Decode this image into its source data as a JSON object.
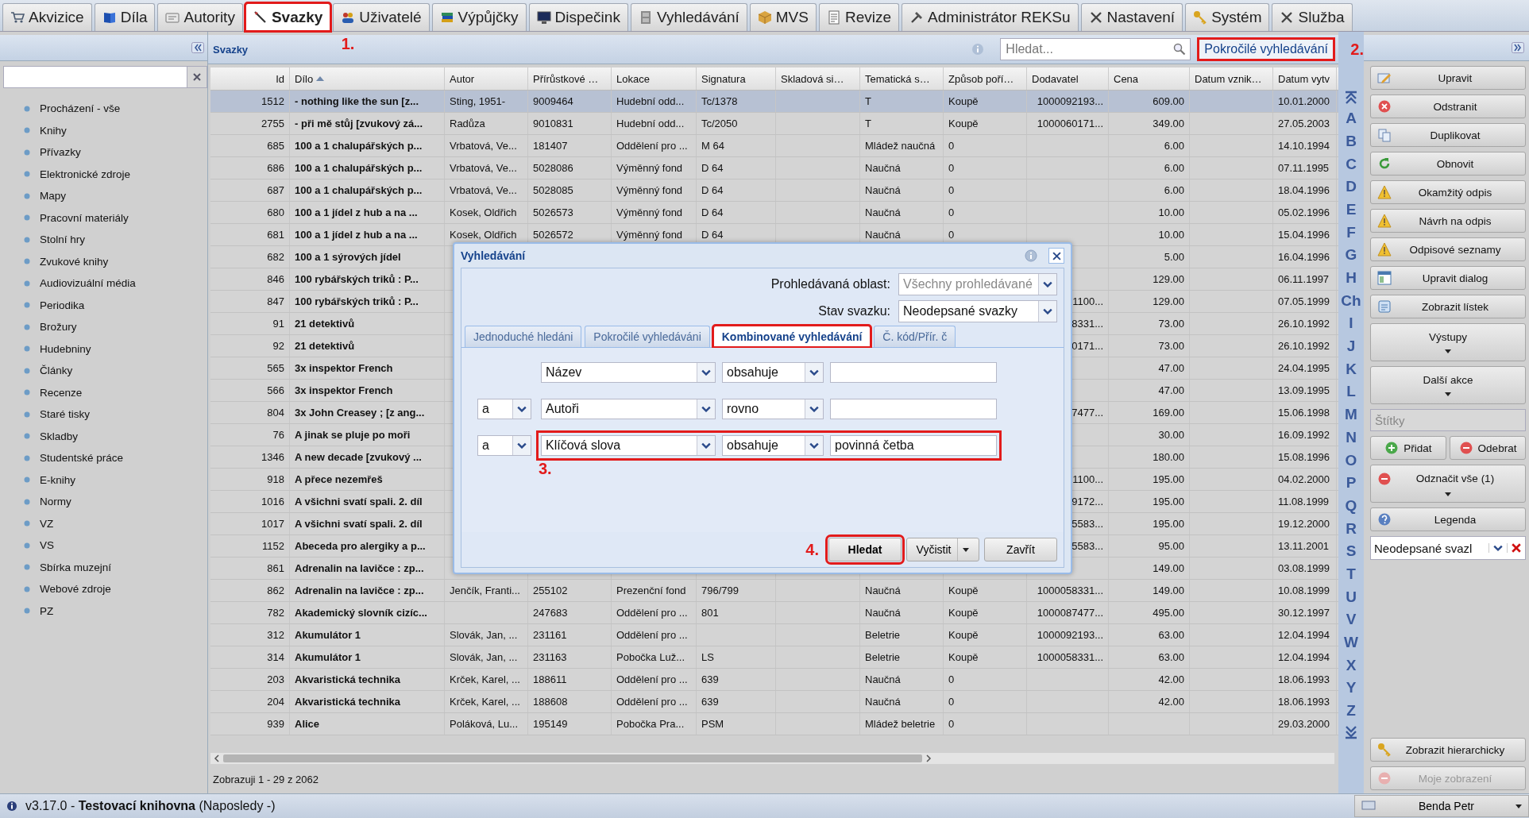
{
  "tabs": [
    {
      "label": "Akvizice",
      "selected": false
    },
    {
      "label": "Díla",
      "selected": false
    },
    {
      "label": "Autority",
      "selected": false
    },
    {
      "label": "Svazky",
      "selected": true,
      "highlighted": true,
      "callout": "1."
    },
    {
      "label": "Uživatelé",
      "selected": false
    },
    {
      "label": "Výpůjčky",
      "selected": false
    },
    {
      "label": "Dispečink",
      "selected": false
    },
    {
      "label": "Vyhledávání",
      "selected": false
    },
    {
      "label": "MVS",
      "selected": false
    },
    {
      "label": "Revize",
      "selected": false
    },
    {
      "label": "Administrátor REKSu",
      "selected": false
    },
    {
      "label": "Nastavení",
      "selected": false
    },
    {
      "label": "Systém",
      "selected": false
    },
    {
      "label": "Služba",
      "selected": false
    }
  ],
  "sidebar": {
    "items": [
      "Procházení - vše",
      "Knihy",
      "Přívazky",
      "Elektronické zdroje",
      "Mapy",
      "Pracovní materiály",
      "Stolní hry",
      "Zvukové knihy",
      "Audiovizuální média",
      "Periodika",
      "Brožury",
      "Hudebniny",
      "Články",
      "Recenze",
      "Staré tisky",
      "Skladby",
      "Studentské práce",
      "E-knihy",
      "Normy",
      "VZ",
      "VS",
      "Sbírka muzejní",
      "Webové zdroje",
      "PZ"
    ]
  },
  "panel": {
    "title": "Svazky",
    "search": {
      "placeholder": "Hledat..."
    },
    "advanced_button": {
      "label": "Pokročilé vyhledávání",
      "highlighted": true,
      "callout": "2."
    }
  },
  "table": {
    "columns": [
      {
        "label": "Id"
      },
      {
        "label": "Dílo",
        "sorted": true
      },
      {
        "label": "Autor"
      },
      {
        "label": "Přírůstkové …"
      },
      {
        "label": "Lokace"
      },
      {
        "label": "Signatura"
      },
      {
        "label": "Skladová si…"
      },
      {
        "label": "Tematická s…"
      },
      {
        "label": "Způsob poří…"
      },
      {
        "label": "Dodavatel"
      },
      {
        "label": "Cena"
      },
      {
        "label": "Datum vznik…"
      },
      {
        "label": "Datum vytv"
      }
    ],
    "rows": [
      {
        "selected": true,
        "cells": [
          "1512",
          "- nothing like the sun [z...",
          "Sting, 1951-",
          "9009464",
          "Hudební odd...",
          "Tc/1378",
          null,
          "T",
          "Koupě",
          "1000092193...",
          "609.00",
          null,
          "10.01.2000"
        ]
      },
      {
        "selected": false,
        "cells": [
          "2755",
          "- při mě stůj [zvukový zá...",
          "Radůza",
          "9010831",
          "Hudební odd...",
          "Tc/2050",
          null,
          "T",
          "Koupě",
          "1000060171...",
          "349.00",
          null,
          "27.05.2003"
        ]
      },
      {
        "selected": false,
        "cells": [
          "685",
          "100 a 1 chalupářských p...",
          "Vrbatová, Ve...",
          "181407",
          "Oddělení pro ...",
          "M 64",
          null,
          "Mládež naučná",
          "0",
          null,
          "6.00",
          null,
          "14.10.1994"
        ]
      },
      {
        "selected": false,
        "cells": [
          "686",
          "100 a 1 chalupářských p...",
          "Vrbatová, Ve...",
          "5028086",
          "Výměnný fond",
          "D 64",
          null,
          "Naučná",
          "0",
          null,
          "6.00",
          null,
          "07.11.1995"
        ]
      },
      {
        "selected": false,
        "cells": [
          "687",
          "100 a 1 chalupářských p...",
          "Vrbatová, Ve...",
          "5028085",
          "Výměnný fond",
          "D 64",
          null,
          "Naučná",
          "0",
          null,
          "6.00",
          null,
          "18.04.1996"
        ]
      },
      {
        "selected": false,
        "cells": [
          "680",
          "100 a 1 jídel z hub a na ...",
          "Kosek, Oldřich",
          "5026573",
          "Výměnný fond",
          "D 64",
          null,
          "Naučná",
          "0",
          null,
          "10.00",
          null,
          "05.02.1996"
        ]
      },
      {
        "selected": false,
        "cells": [
          "681",
          "100 a 1 jídel z hub a na ...",
          "Kosek, Oldřich",
          "5026572",
          "Výměnný fond",
          "D 64",
          null,
          "Naučná",
          "0",
          null,
          "10.00",
          null,
          "15.04.1996"
        ]
      },
      {
        "selected": false,
        "cells": [
          "682",
          "100 a 1 sýrových jídel",
          null,
          null,
          null,
          null,
          null,
          null,
          null,
          null,
          "5.00",
          null,
          "16.04.1996"
        ]
      },
      {
        "selected": false,
        "cells": [
          "846",
          "100 rybářských triků : P...",
          null,
          null,
          null,
          null,
          null,
          null,
          null,
          null,
          "129.00",
          null,
          "06.11.1997"
        ]
      },
      {
        "selected": false,
        "cells": [
          "847",
          "100 rybářských triků : P...",
          null,
          null,
          null,
          null,
          null,
          null,
          null,
          "1100...",
          "129.00",
          null,
          "07.05.1999"
        ]
      },
      {
        "selected": false,
        "cells": [
          "91",
          "21 detektivů",
          null,
          null,
          null,
          null,
          null,
          null,
          null,
          "8331...",
          "73.00",
          null,
          "26.10.1992"
        ]
      },
      {
        "selected": false,
        "cells": [
          "92",
          "21 detektivů",
          null,
          null,
          null,
          null,
          null,
          null,
          null,
          "0171...",
          "73.00",
          null,
          "26.10.1992"
        ]
      },
      {
        "selected": false,
        "cells": [
          "565",
          "3x inspektor French",
          null,
          null,
          null,
          null,
          null,
          null,
          null,
          null,
          "47.00",
          null,
          "24.04.1995"
        ]
      },
      {
        "selected": false,
        "cells": [
          "566",
          "3x inspektor French",
          null,
          null,
          null,
          null,
          null,
          null,
          null,
          null,
          "47.00",
          null,
          "13.09.1995"
        ]
      },
      {
        "selected": false,
        "cells": [
          "804",
          "3x John Creasey ; [z ang...",
          null,
          null,
          null,
          null,
          null,
          null,
          null,
          "7477...",
          "169.00",
          null,
          "15.06.1998"
        ]
      },
      {
        "selected": false,
        "cells": [
          "76",
          "A jinak se pluje po moři",
          null,
          null,
          null,
          null,
          null,
          null,
          null,
          null,
          "30.00",
          null,
          "16.09.1992"
        ]
      },
      {
        "selected": false,
        "cells": [
          "1346",
          "A new decade [zvukový ...",
          null,
          null,
          null,
          null,
          null,
          null,
          null,
          null,
          "180.00",
          null,
          "15.08.1996"
        ]
      },
      {
        "selected": false,
        "cells": [
          "918",
          "A přece nezemřeš",
          null,
          null,
          null,
          null,
          null,
          null,
          null,
          "1100...",
          "195.00",
          null,
          "04.02.2000"
        ]
      },
      {
        "selected": false,
        "cells": [
          "1016",
          "A všichni svatí spali. 2. díl",
          null,
          null,
          null,
          null,
          null,
          null,
          null,
          "9172...",
          "195.00",
          null,
          "11.08.1999"
        ]
      },
      {
        "selected": false,
        "cells": [
          "1017",
          "A všichni svatí spali. 2. díl",
          null,
          null,
          null,
          null,
          null,
          null,
          null,
          "5583...",
          "195.00",
          null,
          "19.12.2000"
        ]
      },
      {
        "selected": false,
        "cells": [
          "1152",
          "Abeceda pro alergiky a p...",
          null,
          null,
          null,
          null,
          null,
          null,
          null,
          "5583...",
          "95.00",
          null,
          "13.11.2001"
        ]
      },
      {
        "selected": false,
        "cells": [
          "861",
          "Adrenalin na lavičce : zp...",
          null,
          null,
          null,
          null,
          null,
          null,
          null,
          null,
          "149.00",
          null,
          "03.08.1999"
        ]
      },
      {
        "selected": false,
        "cells": [
          "862",
          "Adrenalin na lavičce : zp...",
          "Jenčík, Franti...",
          "255102",
          "Prezenční fond",
          "796/799",
          null,
          "Naučná",
          "Koupě",
          "1000058331...",
          "149.00",
          null,
          "10.08.1999"
        ]
      },
      {
        "selected": false,
        "cells": [
          "782",
          "Akademický slovník cizíc...",
          null,
          "247683",
          "Oddělení pro ...",
          "801",
          null,
          "Naučná",
          "Koupě",
          "1000087477...",
          "495.00",
          null,
          "30.12.1997"
        ]
      },
      {
        "selected": false,
        "cells": [
          "312",
          "Akumulátor 1",
          "Slovák, Jan, ...",
          "231161",
          "Oddělení pro ...",
          null,
          null,
          "Beletrie",
          "Koupě",
          "1000092193...",
          "63.00",
          null,
          "12.04.1994"
        ]
      },
      {
        "selected": false,
        "cells": [
          "314",
          "Akumulátor 1",
          "Slovák, Jan, ...",
          "231163",
          "Pobočka Luž...",
          "LS",
          null,
          "Beletrie",
          "Koupě",
          "1000058331...",
          "63.00",
          null,
          "12.04.1994"
        ]
      },
      {
        "selected": false,
        "cells": [
          "203",
          "Akvaristická technika",
          "Krček, Karel, ...",
          "188611",
          "Oddělení pro ...",
          "639",
          null,
          "Naučná",
          "0",
          null,
          "42.00",
          null,
          "18.06.1993"
        ]
      },
      {
        "selected": false,
        "cells": [
          "204",
          "Akvaristická technika",
          "Krček, Karel, ...",
          "188608",
          "Oddělení pro ...",
          "639",
          null,
          "Naučná",
          "0",
          null,
          "42.00",
          null,
          "18.06.1993"
        ]
      },
      {
        "selected": false,
        "cells": [
          "939",
          "Alice",
          "Poláková, Lu...",
          "195149",
          "Pobočka Pra...",
          "PSM",
          null,
          "Mládež beletrie",
          "0",
          null,
          null,
          null,
          "29.03.2000"
        ]
      }
    ],
    "footer": "Zobrazuji 1 - 29 z 2062"
  },
  "alphabet": [
    "A",
    "B",
    "C",
    "D",
    "E",
    "F",
    "G",
    "H",
    "Ch",
    "I",
    "J",
    "K",
    "L",
    "M",
    "N",
    "O",
    "P",
    "Q",
    "R",
    "S",
    "T",
    "U",
    "V",
    "W",
    "X",
    "Y",
    "Z"
  ],
  "actions": [
    {
      "label": "Upravit",
      "kind": "button"
    },
    {
      "label": "Odstranit",
      "kind": "button"
    },
    {
      "label": "Duplikovat",
      "kind": "button"
    },
    {
      "label": "Obnovit",
      "kind": "button"
    },
    {
      "label": "Okamžitý odpis",
      "kind": "button"
    },
    {
      "label": "Návrh na odpis",
      "kind": "button"
    },
    {
      "label": "Odpisové seznamy",
      "kind": "button"
    },
    {
      "label": "Upravit dialog",
      "kind": "button"
    },
    {
      "label": "Zobrazit lístek",
      "kind": "button"
    },
    {
      "label": "Výstupy",
      "kind": "menu"
    },
    {
      "label": "Další akce",
      "kind": "menu"
    }
  ],
  "tags_field": {
    "placeholder": "Štítky"
  },
  "tag_buttons": [
    "Přidat",
    "Odebrat"
  ],
  "deselect_button": "Odznačit vše (1)",
  "legend_button": "Legenda",
  "filter_combo": {
    "value": "Neodepsané svazl"
  },
  "bottom_actions": [
    {
      "label": "Zobrazit hierarchicky",
      "disabled": false
    },
    {
      "label": "Moje zobrazení",
      "disabled": true
    }
  ],
  "user_button": "Benda Petr",
  "status": "v3.17.0 - **Testovací knihovna** (Naposledy -)",
  "dialog": {
    "title": "Vyhledávání",
    "fields": [
      {
        "label": "Prohledávaná oblast:",
        "value": "Všechny prohledávané",
        "disabled": true
      },
      {
        "label": "Stav svazku:",
        "value": "Neodepsané svazky",
        "disabled": false
      }
    ],
    "tabs": [
      {
        "label": "Jednoduché hledáni",
        "selected": false
      },
      {
        "label": "Pokročilé vyhledáváni",
        "selected": false
      },
      {
        "label": "Kombinované vyhledávání",
        "selected": true,
        "highlighted": true
      },
      {
        "label": "Č. kód/Přír. č",
        "selected": false
      }
    ],
    "criteria": [
      {
        "field": "Název",
        "condition": "obsahuje",
        "highlighted": false
      },
      {
        "operator": "a",
        "field": "Autoři",
        "condition": "rovno",
        "highlighted": false
      },
      {
        "operator": "a",
        "field": "Klíčová slova",
        "condition": "obsahuje",
        "value": "povinná četba",
        "highlighted": true,
        "callout": "3."
      }
    ],
    "buttons": [
      {
        "label": "Hledat",
        "kind": "primary",
        "highlighted": true,
        "callout": "4."
      },
      {
        "label": "Vyčistit",
        "kind": "split"
      },
      {
        "label": "Zavřít",
        "kind": "plain"
      }
    ]
  }
}
